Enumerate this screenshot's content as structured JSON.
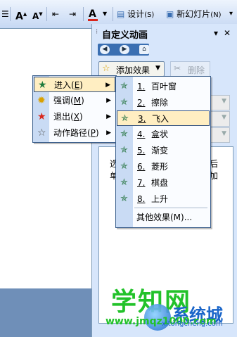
{
  "toolbar": {
    "font_grow_label": "A",
    "font_shrink_label": "A",
    "font_color_label": "A",
    "design_label": "设计",
    "design_shortcut": "(S)",
    "new_slide_label": "新幻灯片",
    "new_slide_shortcut": "(N)",
    "colors": {
      "font_color_bar": "#d8261c"
    }
  },
  "task_pane": {
    "title": "自定义动画",
    "add_effect_label": "添加效果",
    "delete_label": "删除",
    "nav": {
      "back_icon": "back-arrow-icon",
      "forward_icon": "forward-arrow-icon",
      "home_icon": "home-icon"
    },
    "partial_text": [
      "选",
      "单",
      "后",
      "加"
    ]
  },
  "main_menu": {
    "items": [
      {
        "label": "进入",
        "shortcut": "E",
        "icon": "star-green-icon",
        "selected": true
      },
      {
        "label": "强调",
        "shortcut": "M",
        "icon": "star-yellow-icon",
        "selected": false
      },
      {
        "label": "退出",
        "shortcut": "X",
        "icon": "star-red-icon",
        "selected": false
      },
      {
        "label": "动作路径",
        "shortcut": "P",
        "icon": "star-outline-icon",
        "selected": false
      }
    ]
  },
  "sub_menu": {
    "items": [
      {
        "num": "1.",
        "label": "百叶窗",
        "selected": false
      },
      {
        "num": "2.",
        "label": "擦除",
        "selected": false
      },
      {
        "num": "3.",
        "label": "飞入",
        "selected": true
      },
      {
        "num": "4.",
        "label": "盒状",
        "selected": false
      },
      {
        "num": "5.",
        "label": "渐变",
        "selected": false
      },
      {
        "num": "6.",
        "label": "菱形",
        "selected": false
      },
      {
        "num": "7.",
        "label": "棋盘",
        "selected": false
      },
      {
        "num": "8.",
        "label": "上升",
        "selected": false
      }
    ],
    "more_label": "其他效果(M)..."
  },
  "watermark": {
    "big_text": "学知网",
    "url_text": "www.jmqz1000.com",
    "logo_text": "系统城",
    "logo_url": "xitongcheng.com"
  }
}
